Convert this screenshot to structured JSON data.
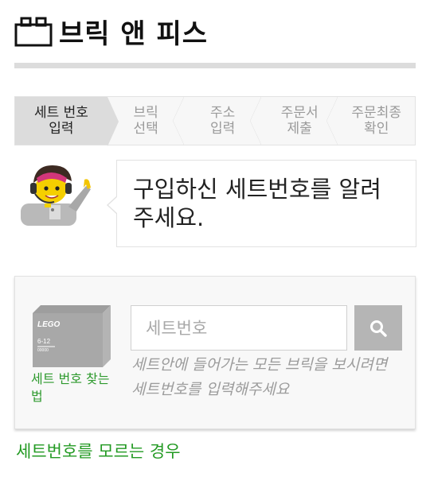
{
  "header": {
    "title": "브릭 앤 피스",
    "icon": "brick-icon"
  },
  "steps": [
    {
      "label": "세트 번호\n입력",
      "active": true
    },
    {
      "label": "브릭\n선택",
      "active": false
    },
    {
      "label": "주소\n입력",
      "active": false
    },
    {
      "label": "주문서\n제출",
      "active": false
    },
    {
      "label": "주문최종\n확인",
      "active": false
    }
  ],
  "assistant": {
    "icon": "lego-minifigure-icon",
    "message": "구입하신 세트번호를 알려 주세요."
  },
  "search_panel": {
    "set_box_text": {
      "logo": "LEGO",
      "age": "6-12",
      "number": "00000"
    },
    "find_link": "세트 번호 찾는 법",
    "input": {
      "placeholder": "세트번호",
      "value": ""
    },
    "search_icon": "search-icon",
    "hint": "세트안에 들어가는 모든 브릭을 보시려면 세트번호를 입력해주세요"
  },
  "bottom_link": "세트번호를 모르는 경우",
  "colors": {
    "accent_green": "#239a23",
    "active_step": "#dcdcdc",
    "button_gray": "#b5b5b5"
  }
}
